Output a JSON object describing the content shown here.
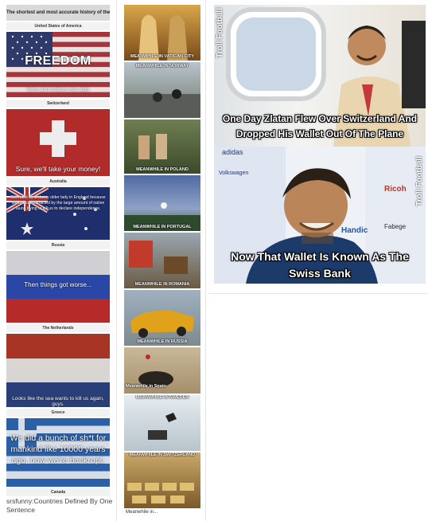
{
  "col1": {
    "title": "The shortest and most accurate history of the world...",
    "sections": [
      {
        "country": "United States of America",
        "text": "FREEDOM",
        "subtext": "*terms and conditions may apply."
      },
      {
        "country": "Switzerland",
        "text": "Sure, we'll take your money!"
      },
      {
        "country": "Australia",
        "text": "Still ruled by a classy older lady in England because we are too distracted by the large amount of native fauna trying to kill us to declare independence."
      },
      {
        "country": "Russia",
        "text": "Then things got worse..."
      },
      {
        "country": "The Netherlands",
        "text": "Looks like the sea wants to kill us again, guys."
      },
      {
        "country": "Greece",
        "text": "We did a bunch of sh*t for mankind like 10000 years ago, now we're bankrupt."
      },
      {
        "country": "Canada"
      }
    ],
    "footer": "srsfunny:Countries Defined By One Sentence"
  },
  "col2": {
    "tiles": [
      "MEANWHILE IN VATICAN CITY",
      "MEANWHILE IN NORWAY",
      "MEANWHILE IN POLAND",
      "MEANWHILE IN PORTUGAL",
      "MEANWHILE IN ROMANIA",
      "MEANWHILE IN RUSSIA",
      "Meanwhile in Spain",
      "MEANWHILE IN SWEDEN",
      "MEANWHILE IN SWITZERLAND"
    ],
    "footer": "Meanwhile in..."
  },
  "col3": {
    "watermark": "Troll Football",
    "panel1_caption": "One Day Zlatan Flew Over Switzerland And Dropped His Wallet Out Of The Plane",
    "panel2_caption": "Now That Wallet Is Known As The Swiss Bank",
    "banner_words": [
      "adidas",
      "Volkswagen",
      "Ricoh",
      "Handic",
      "Fabege"
    ]
  }
}
